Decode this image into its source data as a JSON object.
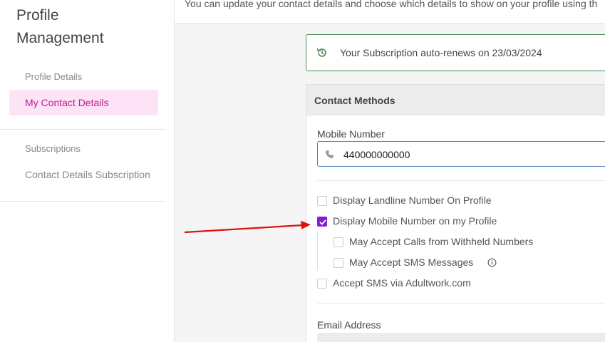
{
  "sidebar": {
    "title_line1": "Profile",
    "title_line2": "Management",
    "sections": [
      {
        "label": "Profile Details",
        "items": [
          {
            "label": "My Contact Details",
            "active": true
          }
        ]
      },
      {
        "label": "Subscriptions",
        "items": [
          {
            "label": "Contact Details Subscription",
            "active": false
          }
        ]
      }
    ]
  },
  "header": {
    "text": "You can update your contact details and choose which details to show on your profile using th"
  },
  "notice": {
    "icon": "history-icon",
    "text": "Your Subscription auto-renews on 23/03/2024",
    "border_color": "#4a8a52"
  },
  "contact_methods": {
    "title": "Contact Methods",
    "mobile_label": "Mobile Number",
    "mobile_value": "440000000000",
    "options": [
      {
        "label": "Display Landline Number On Profile",
        "checked": false
      },
      {
        "label": "Display Mobile Number on my Profile",
        "checked": true
      },
      {
        "label": "May Accept Calls from Withheld Numbers",
        "checked": false
      },
      {
        "label": "May Accept SMS Messages",
        "checked": false,
        "info": true
      },
      {
        "label": "Accept SMS via Adultwork.com",
        "checked": false
      }
    ],
    "email_label": "Email Address"
  },
  "colors": {
    "accent": "#8a1bd1",
    "active_nav_bg": "#fce4f6",
    "active_nav_text": "#c2188d",
    "annotation_arrow": "#e01010"
  }
}
